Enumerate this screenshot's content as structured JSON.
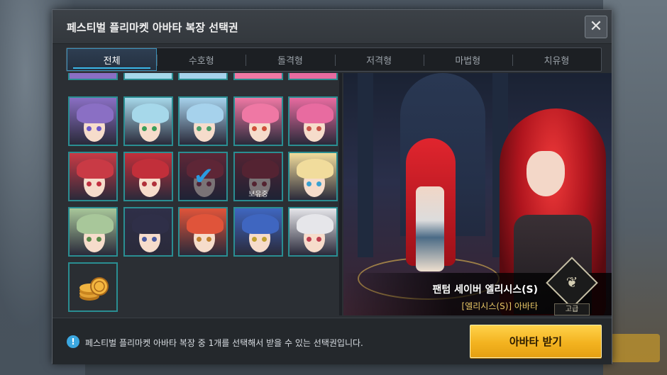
{
  "dialog": {
    "title": "페스티벌 플리마켓 아바타 복장 선택권",
    "close_icon": "close-icon"
  },
  "tabs": [
    {
      "label": "전체",
      "active": true
    },
    {
      "label": "수호형",
      "active": false
    },
    {
      "label": "돌격형",
      "active": false
    },
    {
      "label": "저격형",
      "active": false
    },
    {
      "label": "마법형",
      "active": false
    },
    {
      "label": "치유형",
      "active": false
    }
  ],
  "grid": {
    "owned_label": "보유중",
    "selected_icon": "checkmark-icon",
    "rows": [
      [
        {
          "hair": "#8a6fc4"
        },
        {
          "hair": "#a6d8ea"
        },
        {
          "hair": "#a6d2ec"
        },
        {
          "hair": "#ef78a4"
        },
        {
          "hair": "#e86ba0"
        }
      ],
      [
        {
          "hair": "#c93a45"
        },
        {
          "hair": "#c22f3a"
        },
        {
          "hair": "#b8323c",
          "selected": true
        },
        {
          "hair": "#a32b34",
          "owned": true
        },
        {
          "hair": "#f1dc9c"
        }
      ],
      [
        {
          "hair": "#a8c79a"
        },
        {
          "hair": "#2f2f48"
        },
        {
          "hair": "#e0543a"
        },
        {
          "hair": "#3f66c0"
        },
        {
          "hair": "#e6e6ea"
        }
      ]
    ],
    "coin_icon": "gold-coins-icon"
  },
  "preview": {
    "avatar_name": "팬텀 세이버 엘리시스(S)",
    "avatar_sub": "[엘리시스(S)] 아바타",
    "grade_label": "고급",
    "grade_icon": "wing-emblem-icon"
  },
  "footer": {
    "info_icon": "info-icon",
    "info_text": "페스티벌 플리마켓 아바타 복장 중 1개를 선택해서 받을 수 있는 선택권입니다.",
    "receive_button": "아바타 받기"
  },
  "colors": {
    "accent_tab": "#3ab6e6",
    "cell_border": "#2a8e92",
    "button_gold": "#f3b320",
    "subtitle_gold": "#e8c766"
  }
}
